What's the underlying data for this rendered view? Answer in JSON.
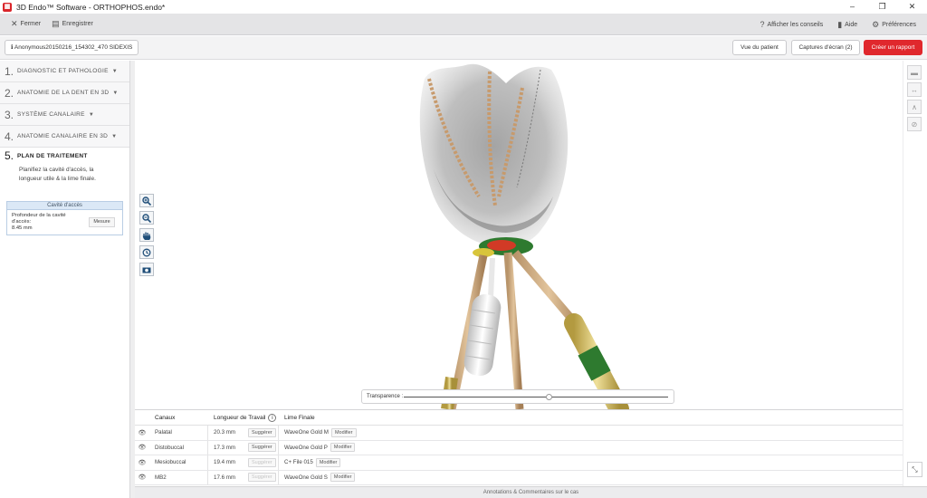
{
  "window": {
    "title": "3D Endo™ Software - ORTHOPHOS.endo*",
    "minimize": "–",
    "restore": "❐",
    "close": "✕"
  },
  "toolbar": {
    "close_label": "Fermer",
    "save_label": "Enregistrer",
    "tips_label": "Afficher les conseils",
    "help_label": "Aide",
    "prefs_label": "Préférences"
  },
  "subbar": {
    "patient": "Anonymous20150216_154302_470 SIDEXIS",
    "patient_view": "Vue du patient",
    "screenshots": "Captures d'écran (2)",
    "create_report": "Créer un rapport"
  },
  "steps": [
    {
      "num": "1.",
      "label": "DIAGNOSTIC ET PATHOLOGIE"
    },
    {
      "num": "2.",
      "label": "ANATOMIE DE LA DENT EN 3D"
    },
    {
      "num": "3.",
      "label": "SYSTÈME CANALAIRE"
    },
    {
      "num": "4.",
      "label": "ANATOMIE CANALAIRE EN 3D"
    },
    {
      "num": "5.",
      "label": "PLAN DE TRAITEMENT",
      "description": "Planifiez la cavité d'accès, la longueur utile & la lime finale."
    }
  ],
  "cavite": {
    "header": "Cavité d'accès",
    "depth_label": "Profondeur de la cavité d'accès:",
    "depth_value": "8.45 mm",
    "measure_button": "Mesure"
  },
  "transparency": {
    "label": "Transparence :",
    "value": 0.55
  },
  "table": {
    "headers": {
      "canal": "Canaux",
      "length": "Longueur de Travail",
      "file": "Lime Finale"
    },
    "suggest": "Suggérer",
    "modify": "Modifier",
    "rows": [
      {
        "canal": "Palatal",
        "length": "20.3 mm",
        "file": "WaveOne Gold M",
        "suggest_enabled": true
      },
      {
        "canal": "Distobuccal",
        "length": "17.3 mm",
        "file": "WaveOne Gold P",
        "suggest_enabled": true
      },
      {
        "canal": "Mesiobuccal",
        "length": "19.4 mm",
        "file": "C+ File 015",
        "suggest_enabled": false
      },
      {
        "canal": "MB2",
        "length": "17.6 mm",
        "file": "WaveOne Gold S",
        "suggest_enabled": false
      }
    ]
  },
  "footer": {
    "label": "Annotations & Commentaires sur le cas"
  },
  "colors": {
    "accent": "#e0282d",
    "panel_header": "#dbe8f6"
  }
}
